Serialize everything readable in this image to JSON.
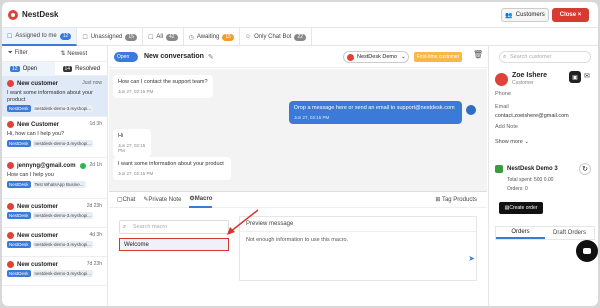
{
  "app": {
    "name": "NestDesk"
  },
  "header": {
    "customers_label": "Customers",
    "close_label": "Close ×"
  },
  "tabs": [
    {
      "label": "Assigned to me",
      "count": "12"
    },
    {
      "label": "Unassigned",
      "count": "15"
    },
    {
      "label": "All",
      "count": "42"
    },
    {
      "label": "Awaiting",
      "count": "15"
    },
    {
      "label": "Only Chat Bot",
      "count": "22"
    }
  ],
  "left": {
    "filter_label": "Filter",
    "sort_label": "Newest",
    "open_count": "12",
    "open_label": "Open",
    "resolved_count": "14",
    "resolved_label": "Resolved",
    "conversations": [
      {
        "name": "New customer",
        "time": "Just now",
        "msg": "I want some information about your product",
        "tag": "NestDesk",
        "tag2": "nestdesk-demo-3.myshopi..."
      },
      {
        "name": "New Customer",
        "time": "1d 3h",
        "msg": "Hi, how can I help you?",
        "tag": "NestDesk",
        "tag2": "nestdesk-demo-3.myshopi..."
      },
      {
        "name": "jennyng@gmail.com",
        "time": "2d 1h",
        "msg": "How can I help you",
        "tag": "NestDesk",
        "tag2": "Test WhatsApp Busine..."
      },
      {
        "name": "New customer",
        "time": "2d 23h",
        "msg": "",
        "tag": "NestDesk",
        "tag2": "nestdesk-demo-3.myshopi..."
      },
      {
        "name": "New customer",
        "time": "4d 3h",
        "msg": "",
        "tag": "NestDesk",
        "tag2": "nestdesk-demo-3.myshopi..."
      },
      {
        "name": "New customer",
        "time": "7d 23h",
        "msg": "",
        "tag": "NestDesk",
        "tag2": "nestdesk-demo-3.myshopi..."
      }
    ]
  },
  "chat": {
    "toggle_label": "Open",
    "title": "New conversation",
    "agent": "NestDesk Demo",
    "first_time_label": "First-time customer",
    "messages": [
      {
        "text": "How can I contact the support team?",
        "time": "Jun 27, 02:15 PM"
      },
      {
        "text": "Drop a message here or send an email to support@nestdesk.com",
        "time": "Jun 27, 02:15 PM"
      },
      {
        "text": "Hi",
        "time": "Jun 27, 02:15 PM"
      },
      {
        "text": "I want some information about your product",
        "time": "Jun 27, 02:15 PM"
      }
    ]
  },
  "composer": {
    "tabs": [
      "Chat",
      "Private Note",
      "Macro"
    ],
    "tag_products": "Tag Products",
    "search_placeholder": "Search macro",
    "macro_item": "Welcome",
    "preview_title": "Preview message",
    "preview_body": "Not enough information to use this macro."
  },
  "right": {
    "search_placeholder": "Search customer",
    "customer_name": "Zoe Ishere",
    "customer_role": "Customer",
    "phone_label": "Phone",
    "email_label": "Email",
    "email_value": "contact.zoeishere@gmail.com",
    "add_note": "Add Note",
    "show_more": "Show more ⌄",
    "store_name": "NestDesk Demo 3",
    "total_spent": "Total spent: 500 0.00",
    "orders": "Orders: 0",
    "create_order": "Create order",
    "order_tabs": [
      "Orders",
      "Draft Orders"
    ]
  }
}
